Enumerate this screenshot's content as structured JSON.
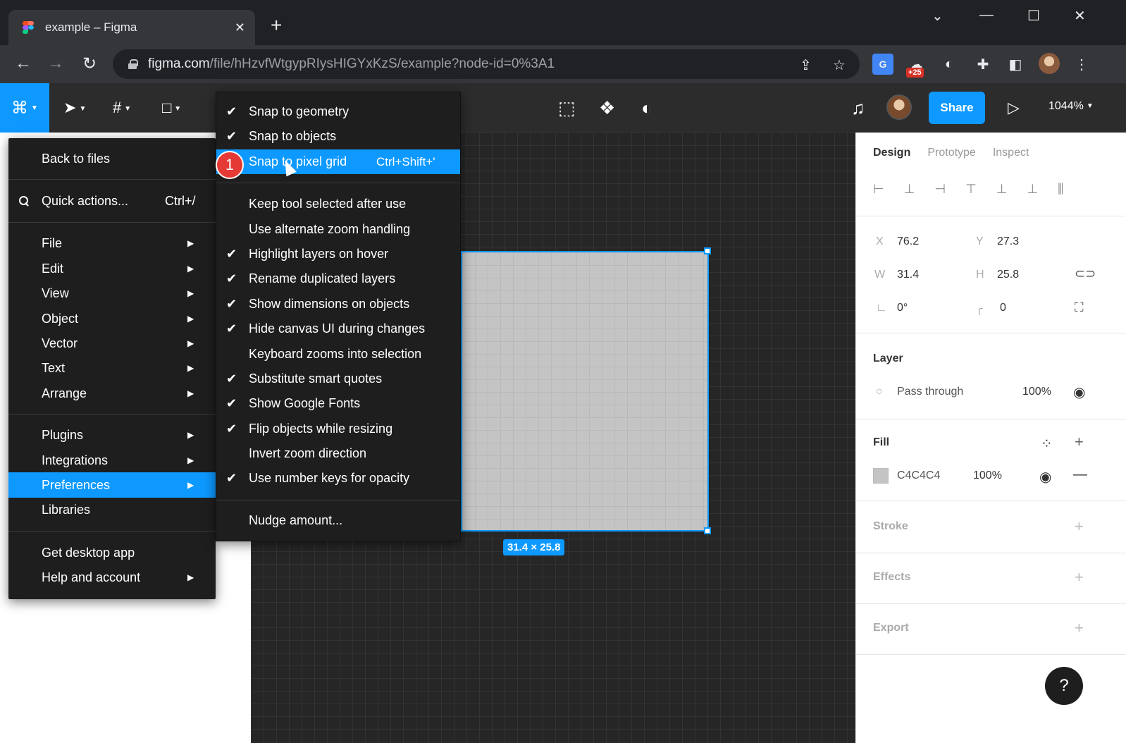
{
  "browser": {
    "tab_title": "example – Figma",
    "url_domain": "figma.com",
    "url_path": "/file/hHzvfWtgypRIysHIGYxKzS/example?node-id=0%3A1",
    "extension_badge": "+25"
  },
  "toolbar": {
    "share_label": "Share",
    "zoom_label": "1044%"
  },
  "canvas": {
    "dimension_label": "31.4 × 25.8"
  },
  "main_menu": {
    "back": "Back to files",
    "quick_actions": "Quick actions...",
    "quick_actions_shortcut": "Ctrl+/",
    "file": "File",
    "edit": "Edit",
    "view": "View",
    "object": "Object",
    "vector": "Vector",
    "text": "Text",
    "arrange": "Arrange",
    "plugins": "Plugins",
    "integrations": "Integrations",
    "preferences": "Preferences",
    "libraries": "Libraries",
    "desktop_app": "Get desktop app",
    "help": "Help and account"
  },
  "pref_menu": {
    "items": [
      {
        "label": "Snap to geometry",
        "checked": true
      },
      {
        "label": "Snap to objects",
        "checked": true
      },
      {
        "label": "Snap to pixel grid",
        "checked": false,
        "shortcut": "Ctrl+Shift+'"
      },
      {
        "label": "Keep tool selected after use",
        "checked": false
      },
      {
        "label": "Use alternate zoom handling",
        "checked": false
      },
      {
        "label": "Highlight layers on hover",
        "checked": true
      },
      {
        "label": "Rename duplicated layers",
        "checked": true
      },
      {
        "label": "Show dimensions on objects",
        "checked": true
      },
      {
        "label": "Hide canvas UI during changes",
        "checked": true
      },
      {
        "label": "Keyboard zooms into selection",
        "checked": false
      },
      {
        "label": "Substitute smart quotes",
        "checked": true
      },
      {
        "label": "Show Google Fonts",
        "checked": true
      },
      {
        "label": "Flip objects while resizing",
        "checked": true
      },
      {
        "label": "Invert zoom direction",
        "checked": false
      },
      {
        "label": "Use number keys for opacity",
        "checked": true
      },
      {
        "label": "Nudge amount...",
        "checked": false
      }
    ],
    "check_glyph": "✔"
  },
  "step_badge": "1",
  "right_panel": {
    "tabs": [
      "Design",
      "Prototype",
      "Inspect"
    ],
    "x_label": "X",
    "x_value": "76.2",
    "y_label": "Y",
    "y_value": "27.3",
    "w_label": "W",
    "w_value": "31.4",
    "h_label": "H",
    "h_value": "25.8",
    "rotation": "0°",
    "radius": "0",
    "layer_title": "Layer",
    "blend_mode": "Pass through",
    "layer_opacity": "100%",
    "fill_title": "Fill",
    "fill_hex": "C4C4C4",
    "fill_opacity": "100%",
    "stroke_title": "Stroke",
    "effects_title": "Effects",
    "export_title": "Export",
    "help": "?"
  }
}
